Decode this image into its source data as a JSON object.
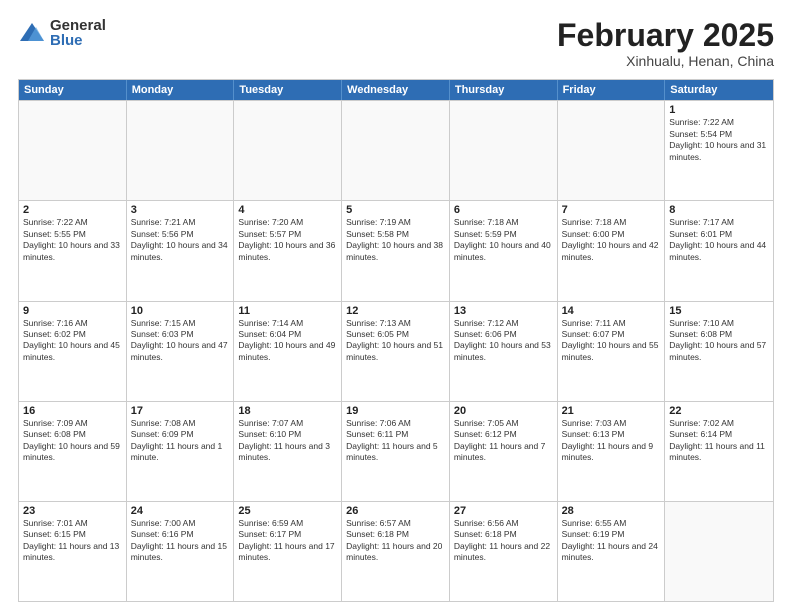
{
  "header": {
    "logo": {
      "general": "General",
      "blue": "Blue"
    },
    "title": "February 2025",
    "location": "Xinhualu, Henan, China"
  },
  "weekdays": [
    "Sunday",
    "Monday",
    "Tuesday",
    "Wednesday",
    "Thursday",
    "Friday",
    "Saturday"
  ],
  "rows": [
    [
      {
        "day": "",
        "info": ""
      },
      {
        "day": "",
        "info": ""
      },
      {
        "day": "",
        "info": ""
      },
      {
        "day": "",
        "info": ""
      },
      {
        "day": "",
        "info": ""
      },
      {
        "day": "",
        "info": ""
      },
      {
        "day": "1",
        "info": "Sunrise: 7:22 AM\nSunset: 5:54 PM\nDaylight: 10 hours and 31 minutes."
      }
    ],
    [
      {
        "day": "2",
        "info": "Sunrise: 7:22 AM\nSunset: 5:55 PM\nDaylight: 10 hours and 33 minutes."
      },
      {
        "day": "3",
        "info": "Sunrise: 7:21 AM\nSunset: 5:56 PM\nDaylight: 10 hours and 34 minutes."
      },
      {
        "day": "4",
        "info": "Sunrise: 7:20 AM\nSunset: 5:57 PM\nDaylight: 10 hours and 36 minutes."
      },
      {
        "day": "5",
        "info": "Sunrise: 7:19 AM\nSunset: 5:58 PM\nDaylight: 10 hours and 38 minutes."
      },
      {
        "day": "6",
        "info": "Sunrise: 7:18 AM\nSunset: 5:59 PM\nDaylight: 10 hours and 40 minutes."
      },
      {
        "day": "7",
        "info": "Sunrise: 7:18 AM\nSunset: 6:00 PM\nDaylight: 10 hours and 42 minutes."
      },
      {
        "day": "8",
        "info": "Sunrise: 7:17 AM\nSunset: 6:01 PM\nDaylight: 10 hours and 44 minutes."
      }
    ],
    [
      {
        "day": "9",
        "info": "Sunrise: 7:16 AM\nSunset: 6:02 PM\nDaylight: 10 hours and 45 minutes."
      },
      {
        "day": "10",
        "info": "Sunrise: 7:15 AM\nSunset: 6:03 PM\nDaylight: 10 hours and 47 minutes."
      },
      {
        "day": "11",
        "info": "Sunrise: 7:14 AM\nSunset: 6:04 PM\nDaylight: 10 hours and 49 minutes."
      },
      {
        "day": "12",
        "info": "Sunrise: 7:13 AM\nSunset: 6:05 PM\nDaylight: 10 hours and 51 minutes."
      },
      {
        "day": "13",
        "info": "Sunrise: 7:12 AM\nSunset: 6:06 PM\nDaylight: 10 hours and 53 minutes."
      },
      {
        "day": "14",
        "info": "Sunrise: 7:11 AM\nSunset: 6:07 PM\nDaylight: 10 hours and 55 minutes."
      },
      {
        "day": "15",
        "info": "Sunrise: 7:10 AM\nSunset: 6:08 PM\nDaylight: 10 hours and 57 minutes."
      }
    ],
    [
      {
        "day": "16",
        "info": "Sunrise: 7:09 AM\nSunset: 6:08 PM\nDaylight: 10 hours and 59 minutes."
      },
      {
        "day": "17",
        "info": "Sunrise: 7:08 AM\nSunset: 6:09 PM\nDaylight: 11 hours and 1 minute."
      },
      {
        "day": "18",
        "info": "Sunrise: 7:07 AM\nSunset: 6:10 PM\nDaylight: 11 hours and 3 minutes."
      },
      {
        "day": "19",
        "info": "Sunrise: 7:06 AM\nSunset: 6:11 PM\nDaylight: 11 hours and 5 minutes."
      },
      {
        "day": "20",
        "info": "Sunrise: 7:05 AM\nSunset: 6:12 PM\nDaylight: 11 hours and 7 minutes."
      },
      {
        "day": "21",
        "info": "Sunrise: 7:03 AM\nSunset: 6:13 PM\nDaylight: 11 hours and 9 minutes."
      },
      {
        "day": "22",
        "info": "Sunrise: 7:02 AM\nSunset: 6:14 PM\nDaylight: 11 hours and 11 minutes."
      }
    ],
    [
      {
        "day": "23",
        "info": "Sunrise: 7:01 AM\nSunset: 6:15 PM\nDaylight: 11 hours and 13 minutes."
      },
      {
        "day": "24",
        "info": "Sunrise: 7:00 AM\nSunset: 6:16 PM\nDaylight: 11 hours and 15 minutes."
      },
      {
        "day": "25",
        "info": "Sunrise: 6:59 AM\nSunset: 6:17 PM\nDaylight: 11 hours and 17 minutes."
      },
      {
        "day": "26",
        "info": "Sunrise: 6:57 AM\nSunset: 6:18 PM\nDaylight: 11 hours and 20 minutes."
      },
      {
        "day": "27",
        "info": "Sunrise: 6:56 AM\nSunset: 6:18 PM\nDaylight: 11 hours and 22 minutes."
      },
      {
        "day": "28",
        "info": "Sunrise: 6:55 AM\nSunset: 6:19 PM\nDaylight: 11 hours and 24 minutes."
      },
      {
        "day": "",
        "info": ""
      }
    ]
  ]
}
